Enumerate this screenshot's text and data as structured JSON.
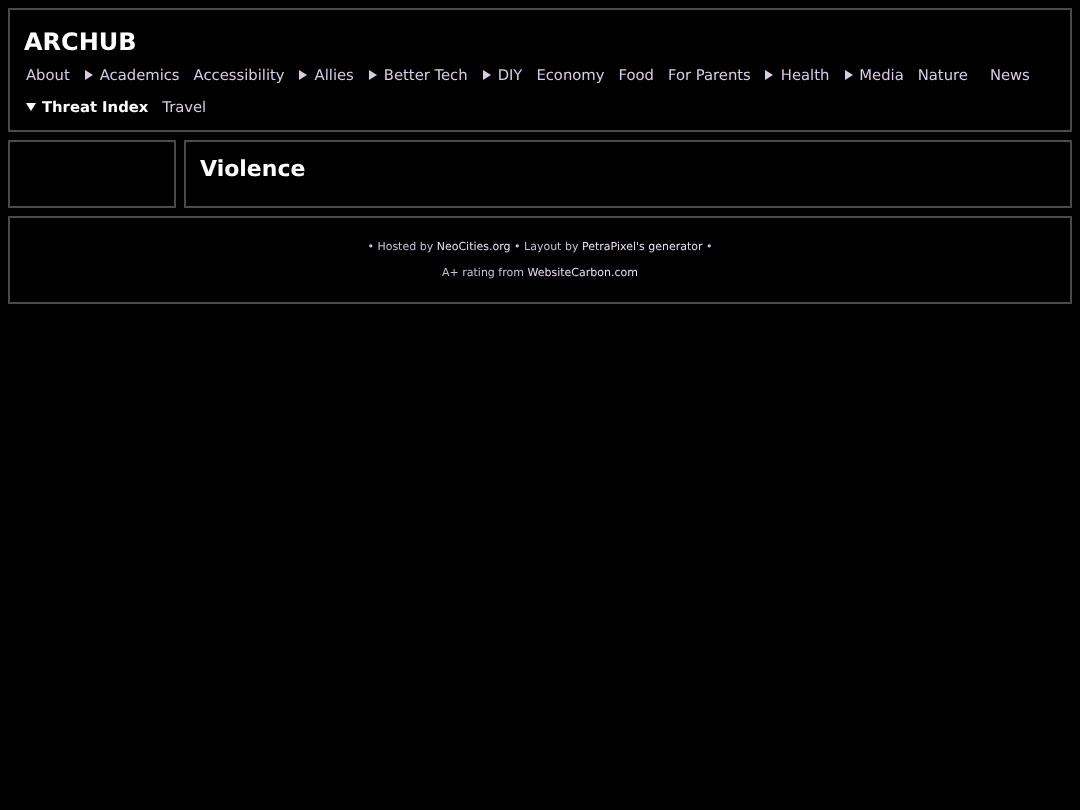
{
  "site_title": "ARCHUB",
  "nav": [
    {
      "label": "About",
      "kind": "link"
    },
    {
      "label": "Academics",
      "kind": "menu",
      "expanded": false
    },
    {
      "label": "Accessibility",
      "kind": "link"
    },
    {
      "label": "Allies",
      "kind": "menu",
      "expanded": false
    },
    {
      "label": "Better Tech",
      "kind": "menu",
      "expanded": false
    },
    {
      "label": "DIY",
      "kind": "menu",
      "expanded": false
    },
    {
      "label": "Economy",
      "kind": "link"
    },
    {
      "label": "Food",
      "kind": "link"
    },
    {
      "label": "For Parents",
      "kind": "link"
    },
    {
      "label": "Health",
      "kind": "menu",
      "expanded": false
    },
    {
      "label": "Media",
      "kind": "menu",
      "expanded": false
    },
    {
      "label": "Nature",
      "kind": "link"
    },
    {
      "label": "News",
      "kind": "link"
    },
    {
      "label": "Threat Index",
      "kind": "menu",
      "expanded": true
    },
    {
      "label": "Travel",
      "kind": "link"
    }
  ],
  "page_heading": "Violence",
  "footer": [
    [
      {
        "text": "• Hosted by ",
        "kind": "text"
      },
      {
        "text": "NeoCities.org",
        "kind": "link"
      },
      {
        "text": " • Layout by ",
        "kind": "text"
      },
      {
        "text": "PetraPixel's generator",
        "kind": "link"
      },
      {
        "text": " •",
        "kind": "text"
      }
    ],
    [
      {
        "text": "A+ rating from ",
        "kind": "text"
      },
      {
        "text": "WebsiteCarbon.com",
        "kind": "link"
      }
    ]
  ]
}
